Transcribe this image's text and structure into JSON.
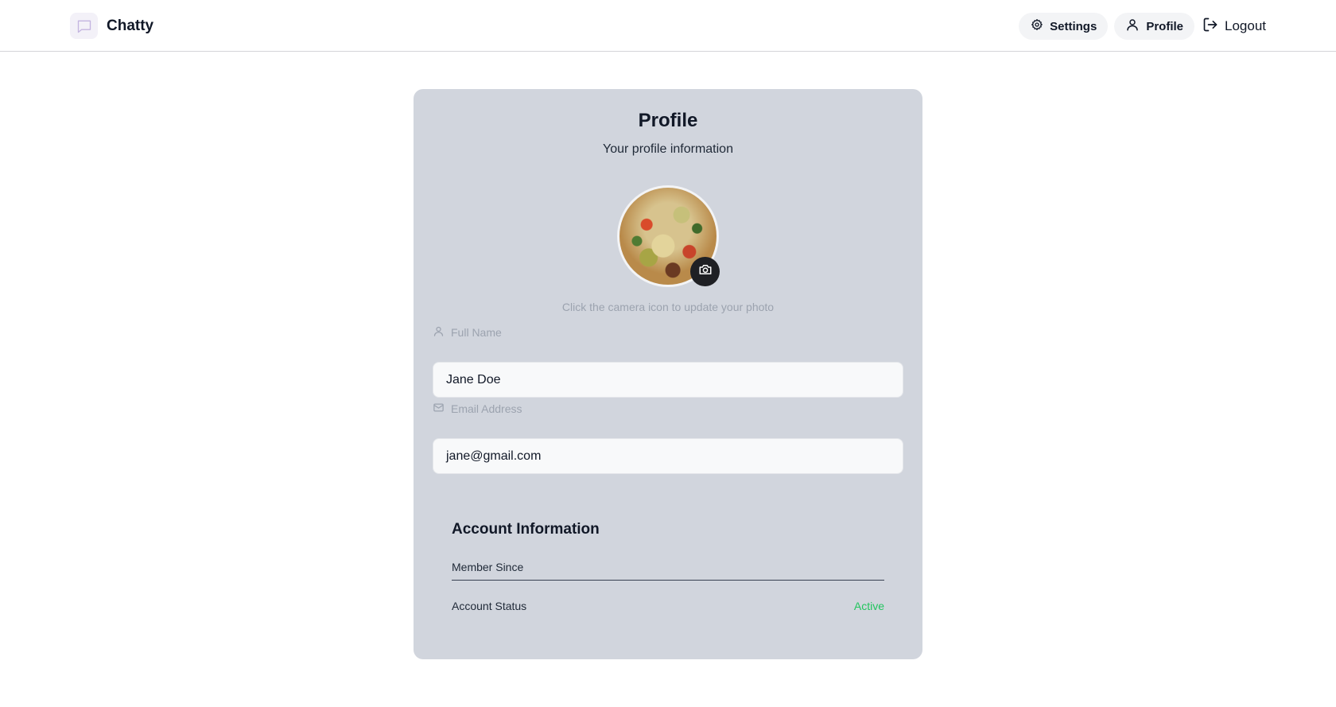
{
  "header": {
    "brand": "Chatty",
    "nav": {
      "settings": "Settings",
      "profile": "Profile",
      "logout": "Logout"
    }
  },
  "card": {
    "title": "Profile",
    "subtitle": "Your profile information",
    "avatar_hint": "Click the camera icon to update your photo",
    "fields": {
      "full_name": {
        "label": "Full Name",
        "value": "Jane Doe"
      },
      "email": {
        "label": "Email Address",
        "value": "jane@gmail.com"
      }
    },
    "account": {
      "title": "Account Information",
      "member_since_label": "Member Since",
      "member_since_value": "",
      "status_label": "Account Status",
      "status_value": "Active"
    }
  },
  "colors": {
    "card_bg": "#d1d5dd",
    "status_active": "#22c55e",
    "camera_button": "#1f2024"
  },
  "icons": [
    "message-square-icon",
    "gear-icon",
    "user-icon",
    "logout-icon",
    "camera-icon",
    "mail-icon"
  ]
}
